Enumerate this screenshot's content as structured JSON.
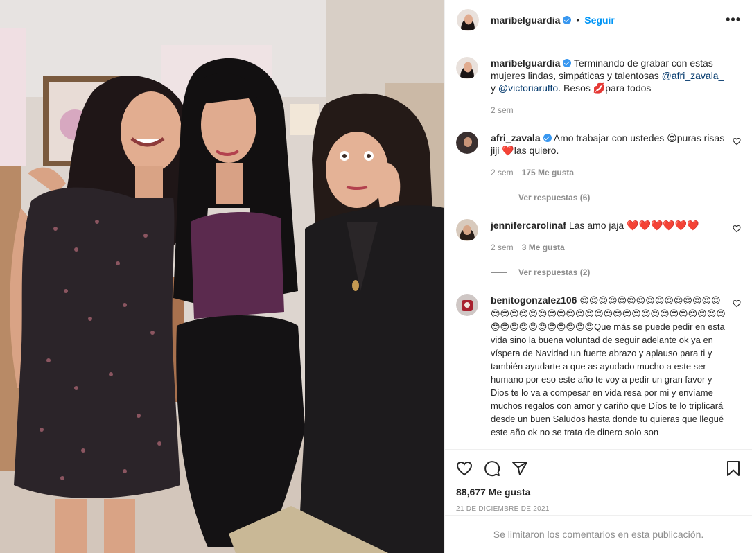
{
  "post": {
    "username": "maribelguardia",
    "follow_label": "Seguir",
    "dot": "•",
    "more_label": "•••",
    "caption_text": "Terminando de grabar con estas mujeres lindas, simpáticas y talentosas",
    "caption_mention1": "@afri_zavala_",
    "caption_and": "y",
    "caption_mention2": "@victoriaruffo",
    "caption_end": ". Besos 💋para todos",
    "caption_time": "2 sem"
  },
  "comments": [
    {
      "username": "afri_zavala",
      "verified": true,
      "text": "Amo trabajar con ustedes 😍puras risas jiji ❤️las quiero.",
      "time": "2 sem",
      "likes": "175 Me gusta",
      "replies": "Ver respuestas (6)"
    },
    {
      "username": "jennifercarolinaf",
      "verified": false,
      "text": "Las amo jaja ❤️❤️❤️❤️❤️❤️",
      "time": "2 sem",
      "likes": "3 Me gusta",
      "replies": "Ver respuestas (2)"
    },
    {
      "username": "benitogonzalez106",
      "verified": false,
      "text": "😍😍😍😍😍😍😍😍😍😍😍😍😍😍😍😍😍😍😍😍😍😍😍😍😍😍😍😍😍😍😍😍😍😍😍😍😍😍😍😍😍😍😍😍😍😍😍😍😍😍😍Que más se puede pedir en esta vida sino la buena voluntad de seguir adelante ok ya en víspera de Navidad un fuerte abrazo y aplauso para ti y también ayudarte a que as ayudado mucho a este ser humano por eso este año te voy a pedir un gran favor y Dios te lo va a compesar en vida resa por mi y envíame muchos regalos con amor y cariño que Díos te lo triplicará desde un buen Saludos hasta donde tu quieras que llegué este año ok no se trata de dinero solo son"
    }
  ],
  "footer": {
    "likes": "88,677 Me gusta",
    "date": "21 DE DICIEMBRE DE 2021",
    "limited": "Se limitaron los comentarios en esta publicación."
  },
  "icons": {
    "like": "heart-icon",
    "comment": "comment-icon",
    "share": "share-icon",
    "save": "bookmark-icon"
  },
  "colors": {
    "accent": "#0095f6",
    "verified": "#3897f0",
    "mention": "#00376b",
    "muted": "#8e8e8e"
  }
}
